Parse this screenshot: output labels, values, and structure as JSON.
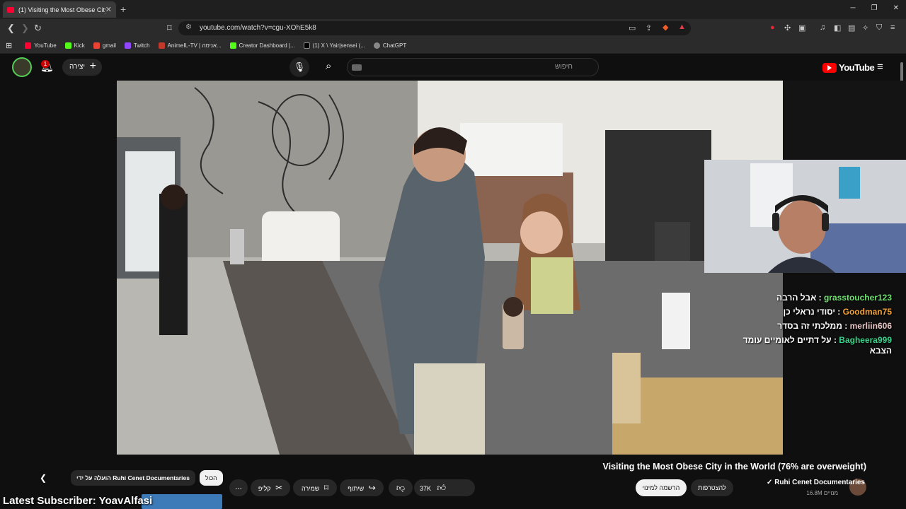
{
  "browser": {
    "tab_title": "(1) Visiting the Most Obese City",
    "url": "youtube.com/watch?v=cgu-XOhE5k8",
    "bookmarks": [
      {
        "label": "YouTube",
        "color": "#ff0033"
      },
      {
        "label": "Kick",
        "color": "#53fc18"
      },
      {
        "label": "gmail",
        "color": "#ea4335"
      },
      {
        "label": "Twitch",
        "color": "#9146ff"
      },
      {
        "label": "AnimeIL-TV | אנימה...",
        "color": "#c0392b"
      },
      {
        "label": "Creator Dashboard |...",
        "color": "#53fc18"
      },
      {
        "label": "(1) X \\ Yair|sensei (...",
        "color": "#000000"
      },
      {
        "label": "ChatGPT",
        "color": "#888888"
      }
    ]
  },
  "youtube": {
    "create_label": "יצירה",
    "notification_count": "1",
    "search_placeholder": "חיפוש",
    "logo_text": "YouTube"
  },
  "chat": [
    {
      "user": "grasstoucher123",
      "text": "אבל הרבה",
      "color": "#6ee26e"
    },
    {
      "user": "Goodman75",
      "text": "יסודי נראלי כן",
      "color": "#f2a33a"
    },
    {
      "user": "merliin606",
      "text": "ממלכתי זה בסדר",
      "color": "#e8c7c7"
    },
    {
      "user": "Bagheera999",
      "text": "על דתיים לאומיים עומד הצבא",
      "color": "#3ad48c"
    }
  ],
  "video": {
    "title": "Visiting the Most Obese City in the World (76% are overweight)",
    "channel": "Ruhi Cenet Documentaries",
    "subscribers": "16.8M מנויים",
    "join_label": "להצטרפות",
    "subscribe_label": "הרשמה למינוי",
    "likes": "37K",
    "share_label": "שיתוף",
    "save_label": "שמירה",
    "clip_label": "קליפ",
    "more_label": "..."
  },
  "chips": {
    "all_label": "הכול",
    "uploaded_by": "הועלה על ידי Ruhi Cenet Documentaries"
  },
  "overlay": {
    "latest_subscriber": "Latest Subscriber: YoavAlfasi"
  }
}
